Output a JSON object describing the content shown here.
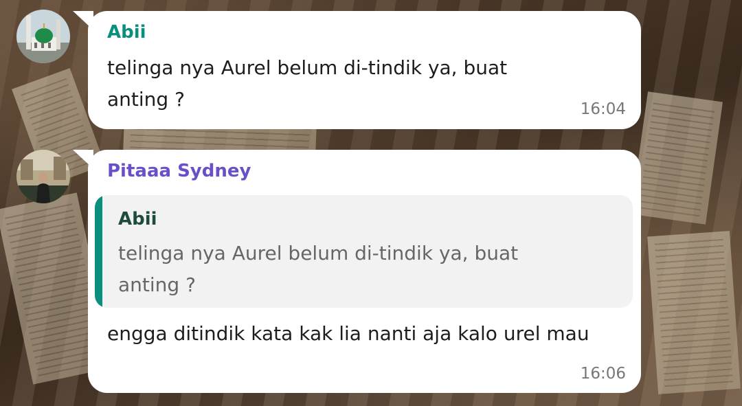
{
  "messages": [
    {
      "sender": "Abii",
      "sender_color": "#0a8f7f",
      "text_line1": "telinga nya Aurel belum di-tindik ya, buat",
      "text_line2": "anting ?",
      "time": "16:04"
    },
    {
      "sender": "Pitaaa Sydney",
      "sender_color": "#6a4fc8",
      "quote": {
        "sender": "Abii",
        "text_line1": "telinga nya Aurel belum di-tindik ya, buat",
        "text_line2": "anting ?"
      },
      "text": "engga ditindik kata kak lia nanti aja kalo urel mau",
      "time": "16:06"
    }
  ],
  "colors": {
    "bubble": "#ffffff",
    "quote_bar": "#0a8f7f",
    "quote_bg": "#f2f2f2"
  }
}
